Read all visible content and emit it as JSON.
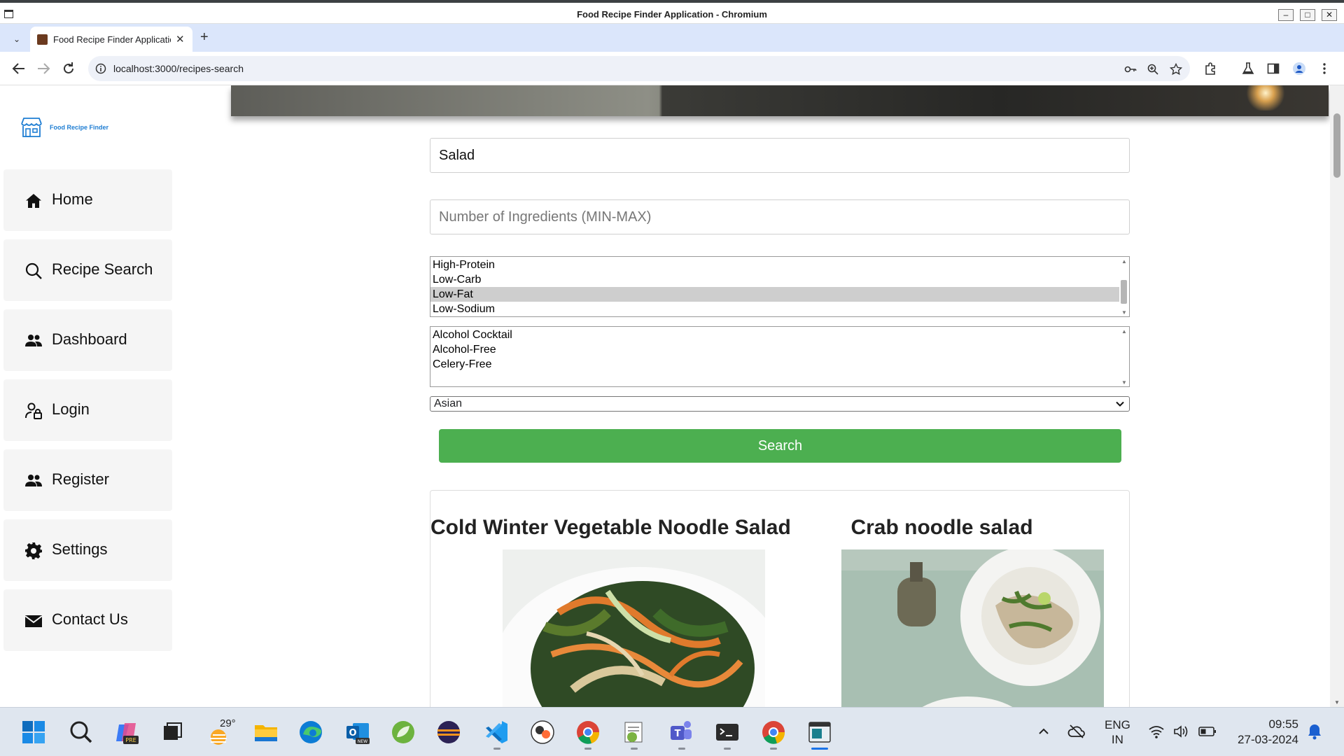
{
  "window": {
    "title": "Food Recipe Finder Application - Chromium",
    "minimize": "–",
    "maximize": "□",
    "close": "✕"
  },
  "tab": {
    "title": "Food Recipe Finder Application",
    "close": "✕",
    "new_tab": "+",
    "tab_list": "⌄"
  },
  "address_bar": {
    "url": "localhost:3000/recipes-search"
  },
  "sidebar": {
    "logo_text": "Food Recipe Finder",
    "items": [
      {
        "label": "Home",
        "icon": "home-icon"
      },
      {
        "label": "Recipe Search",
        "icon": "search-icon"
      },
      {
        "label": "Dashboard",
        "icon": "people-icon"
      },
      {
        "label": "Login",
        "icon": "user-lock-icon"
      },
      {
        "label": "Register",
        "icon": "people-icon"
      },
      {
        "label": "Settings",
        "icon": "gear-icon"
      },
      {
        "label": "Contact Us",
        "icon": "envelope-icon"
      }
    ]
  },
  "search_form": {
    "query_value": "Salad",
    "ingredients_placeholder": "Number of Ingredients (MIN-MAX)",
    "diet_options": [
      "High-Protein",
      "Low-Carb",
      "Low-Fat",
      "Low-Sodium"
    ],
    "diet_selected": "Low-Fat",
    "health_options": [
      "Alcohol Cocktail",
      "Alcohol-Free",
      "Celery-Free"
    ],
    "cuisine_selected": "Asian",
    "search_label": "Search"
  },
  "results": [
    {
      "title": "Cold Winter Vegetable Noodle Salad"
    },
    {
      "title": "Crab noodle salad"
    }
  ],
  "taskbar": {
    "weather_temp": "29°",
    "language": [
      "ENG",
      "IN"
    ],
    "time": "09:55",
    "date": "27-03-2024"
  },
  "colors": {
    "accent": "#4caf50",
    "brand": "#1f7ed3",
    "tabbar": "#dbe6fb"
  }
}
